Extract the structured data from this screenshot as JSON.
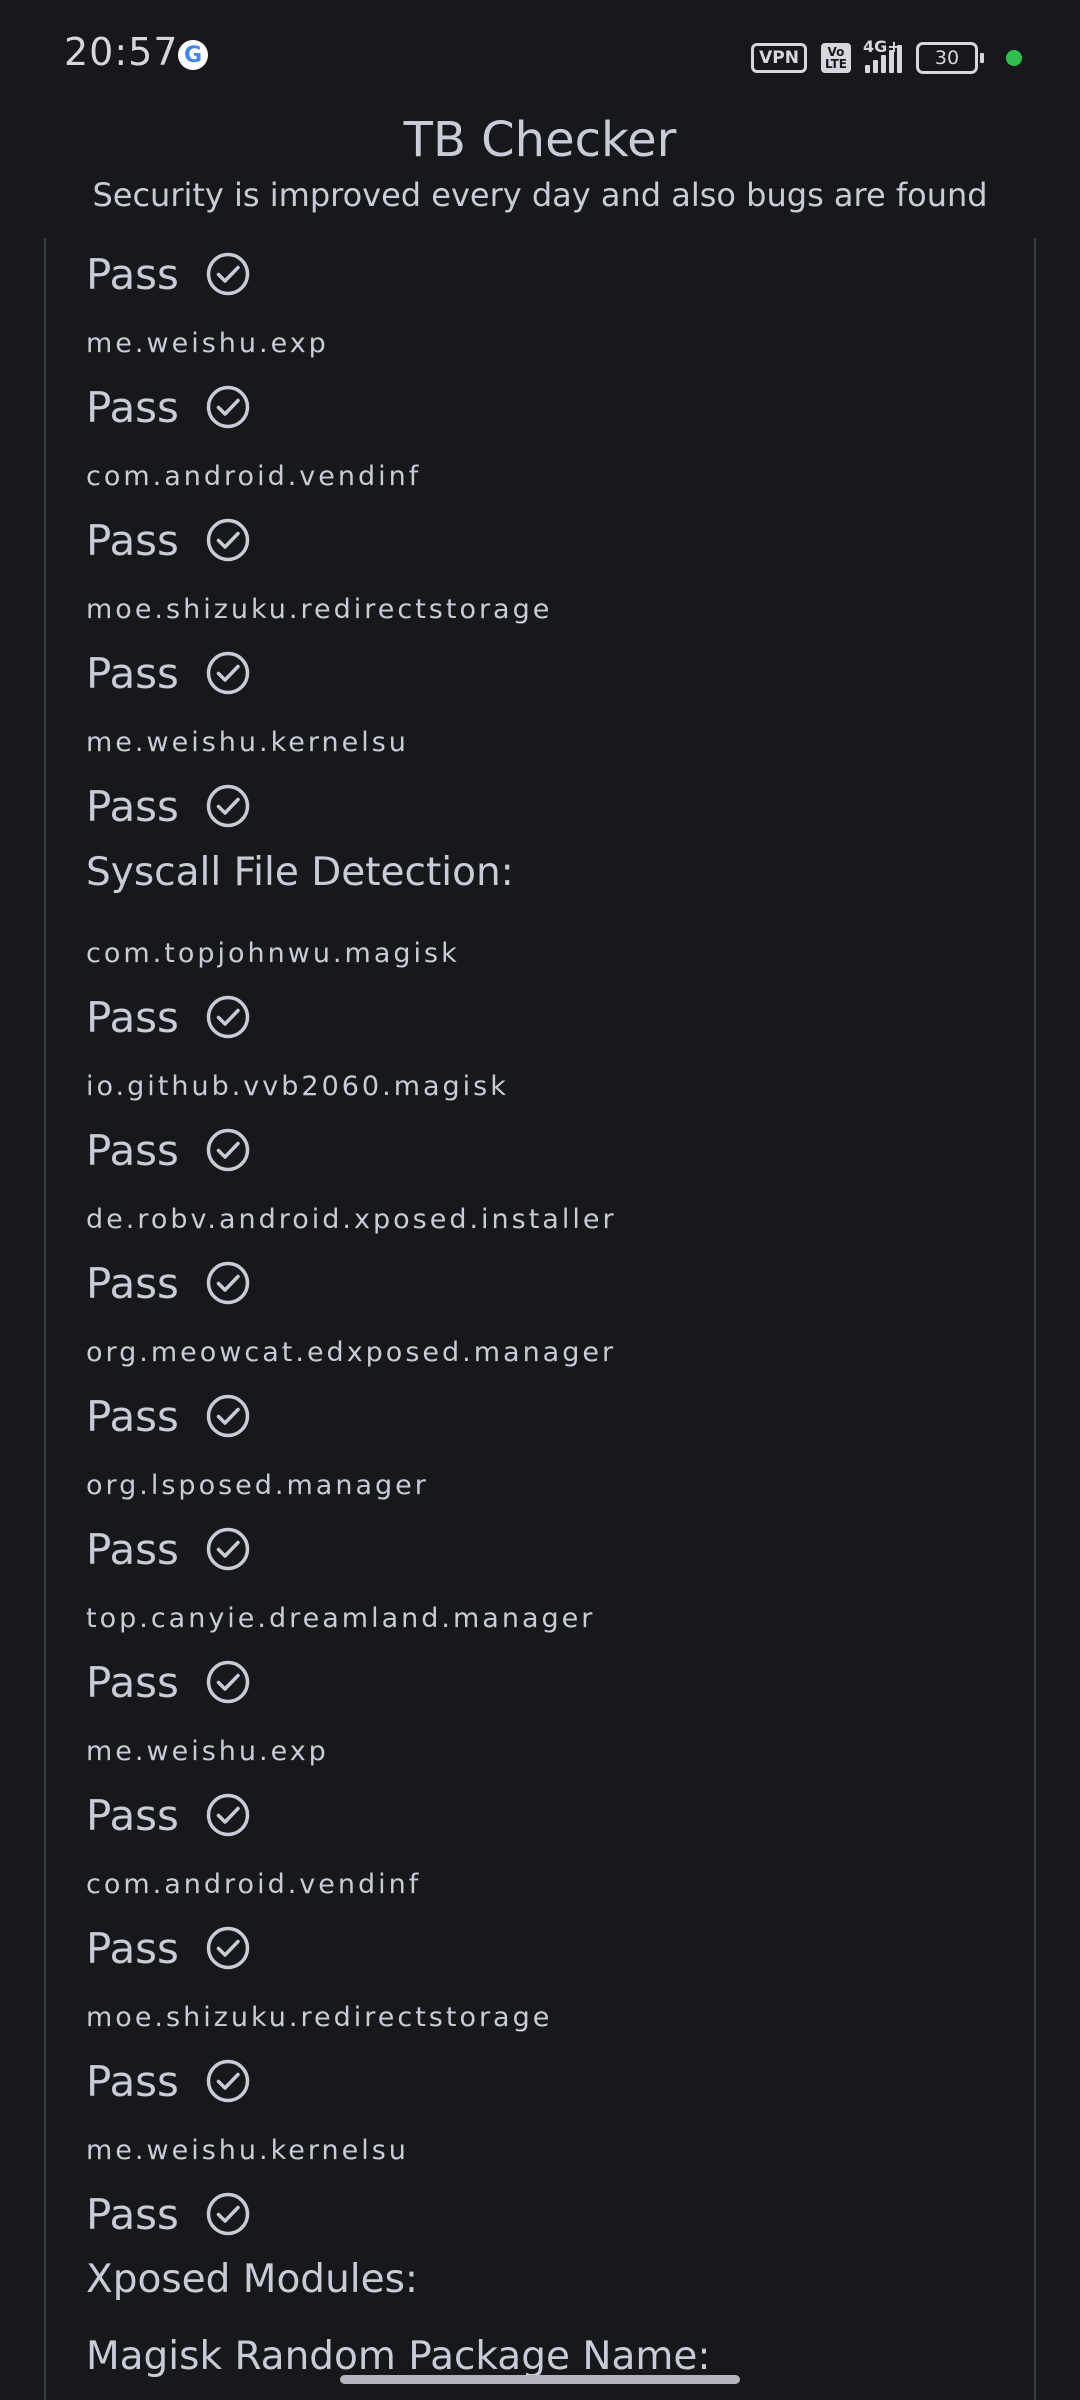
{
  "status_bar": {
    "time": "20:57",
    "google_icon": "google-g-icon",
    "vpn_label": "VPN",
    "volte_label": "Vo LTE",
    "network_label": "4G+",
    "battery_level": "30",
    "colors": {
      "active_dot": "#2fbf4f"
    }
  },
  "header": {
    "title": "TB Checker",
    "subtitle": "Security is improved every day and also bugs are found"
  },
  "results": {
    "pass_label": "Pass",
    "check_icon": "check-circle-icon",
    "top_pass": "Pass",
    "package_checks_1": [
      {
        "package": "me.weishu.exp",
        "status": "Pass"
      },
      {
        "package": "com.android.vendinf",
        "status": "Pass"
      },
      {
        "package": "moe.shizuku.redirectstorage",
        "status": "Pass"
      },
      {
        "package": "me.weishu.kernelsu",
        "status": "Pass"
      }
    ],
    "syscall_section_title": "Syscall File Detection:",
    "syscall_checks": [
      {
        "package": "com.topjohnwu.magisk",
        "status": "Pass"
      },
      {
        "package": "io.github.vvb2060.magisk",
        "status": "Pass"
      },
      {
        "package": "de.robv.android.xposed.installer",
        "status": "Pass"
      },
      {
        "package": "org.meowcat.edxposed.manager",
        "status": "Pass"
      },
      {
        "package": "org.lsposed.manager",
        "status": "Pass"
      },
      {
        "package": "top.canyie.dreamland.manager",
        "status": "Pass"
      },
      {
        "package": "me.weishu.exp",
        "status": "Pass"
      },
      {
        "package": "com.android.vendinf",
        "status": "Pass"
      },
      {
        "package": "moe.shizuku.redirectstorage",
        "status": "Pass"
      },
      {
        "package": "me.weishu.kernelsu",
        "status": "Pass"
      }
    ],
    "xposed_section_title": "Xposed Modules:",
    "magisk_section_title": "Magisk Random Package Name:"
  }
}
